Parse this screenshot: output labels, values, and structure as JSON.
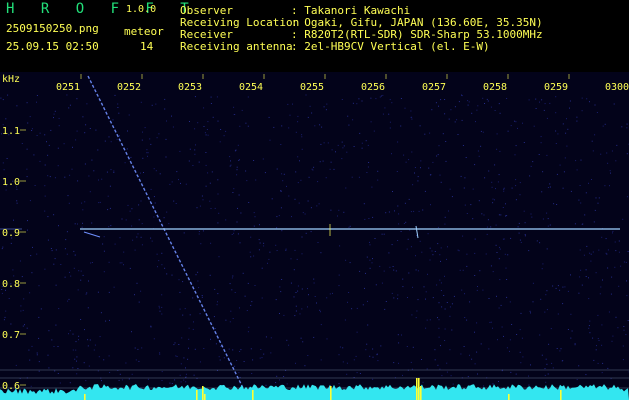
{
  "header": {
    "app_name": "H R O F F T",
    "app_version": "1.0.0",
    "file_name": "2509150250.png",
    "timestamp": "25.09.15 02:50",
    "meteor_label": "meteor",
    "meteor_count": "14",
    "meta": [
      {
        "key": "Observer",
        "value": ": Takanori Kawachi"
      },
      {
        "key": "Receiving Location",
        "value": ": Ogaki, Gifu, JAPAN (136.60E, 35.35N)"
      },
      {
        "key": "Receiver",
        "value": ": R820T2(RTL-SDR) SDR-Sharp 53.1000MHz"
      },
      {
        "key": "Receiving antenna",
        "value": ": 2el-HB9CV Vertical (el. E-W)"
      }
    ]
  },
  "spectrogram": {
    "y_unit": "kHz",
    "y_ticks": [
      "1.1",
      "1.0",
      "0.9",
      "0.8",
      "0.7",
      "0.6"
    ],
    "x_ticks": [
      "0251",
      "0252",
      "0253",
      "0254",
      "0255",
      "0256",
      "0257",
      "0258",
      "0259",
      "0300"
    ],
    "colors": {
      "background": "#03031a",
      "signal": "#6f8fff",
      "carrier": "#9fd0ff",
      "noise_floor": "#33e6f0",
      "spike": "#ffff33",
      "tick_text": "#ffff55"
    }
  }
}
